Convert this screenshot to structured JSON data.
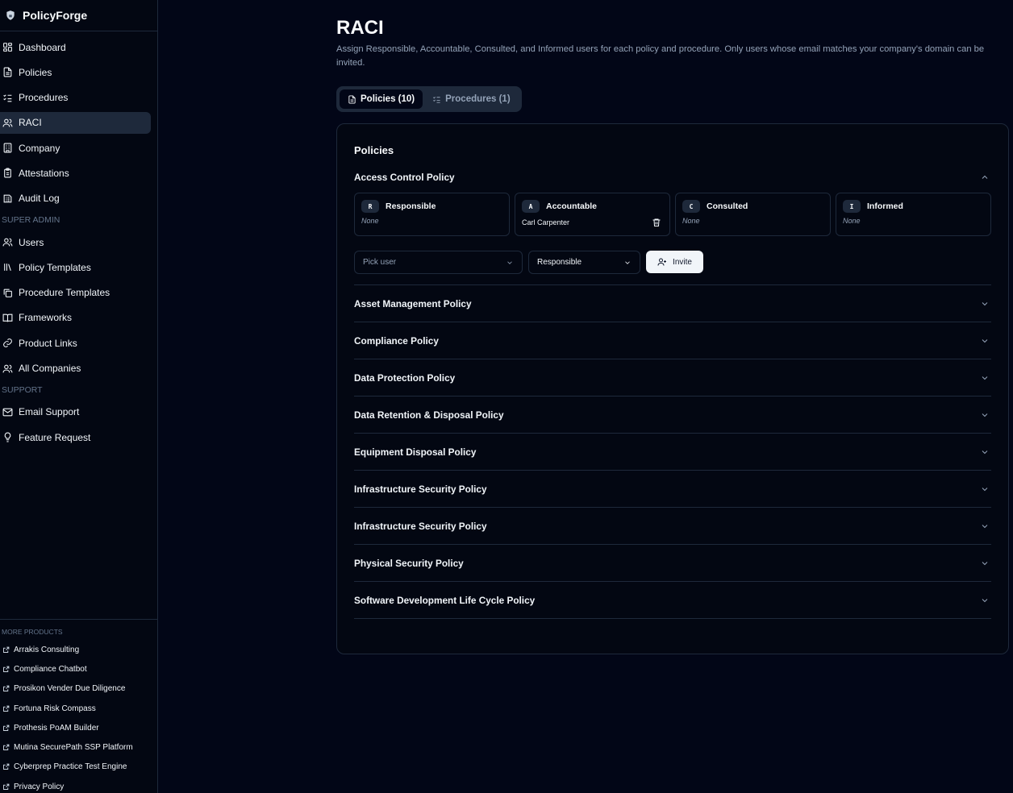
{
  "app": {
    "name": "PolicyForge",
    "logo_icon": "shield-logo-icon"
  },
  "sidebar": {
    "items": [
      {
        "label": "Dashboard",
        "icon": "grid-icon"
      },
      {
        "label": "Policies",
        "icon": "file-text-icon"
      },
      {
        "label": "Procedures",
        "icon": "list-checks-icon"
      },
      {
        "label": "RACI",
        "icon": "users-icon",
        "active": true
      },
      {
        "label": "Company",
        "icon": "building-icon"
      },
      {
        "label": "Attestations",
        "icon": "clipboard-icon"
      },
      {
        "label": "Audit Log",
        "icon": "log-icon"
      }
    ],
    "super_admin_label": "SUPER ADMIN",
    "admin_items": [
      {
        "label": "Users",
        "icon": "users-icon"
      },
      {
        "label": "Policy Templates",
        "icon": "library-icon"
      },
      {
        "label": "Procedure Templates",
        "icon": "copy-icon"
      },
      {
        "label": "Frameworks",
        "icon": "book-open-icon"
      },
      {
        "label": "Product Links",
        "icon": "link-icon"
      },
      {
        "label": "All Companies",
        "icon": "users-icon"
      }
    ],
    "support_label": "SUPPORT",
    "support_items": [
      {
        "label": "Email Support",
        "icon": "mail-icon"
      },
      {
        "label": "Feature Request",
        "icon": "lightbulb-icon"
      }
    ],
    "more_products_label": "MORE PRODUCTS",
    "more_products": [
      "Arrakis Consulting",
      "Compliance Chatbot",
      "Prosikon Vender Due Diligence",
      "Fortuna Risk Compass",
      "Prothesis PoAM Builder",
      "Mutina SecurePath SSP Platform",
      "Cyberprep Practice Test Engine",
      "Privacy Policy"
    ]
  },
  "main": {
    "title": "RACI",
    "description": "Assign Responsible, Accountable, Consulted, and Informed users for each policy and procedure. Only users whose email matches your company's domain can be invited.",
    "tabs": [
      {
        "label": "Policies (10)",
        "active": true
      },
      {
        "label": "Procedures (1)",
        "active": false
      }
    ],
    "card_title": "Policies",
    "expanded_policy": {
      "name": "Access Control Policy",
      "roles": [
        {
          "letter": "R",
          "label": "Responsible",
          "value": "None",
          "assigned": false
        },
        {
          "letter": "A",
          "label": "Accountable",
          "value": "Carl Carpenter",
          "assigned": true
        },
        {
          "letter": "C",
          "label": "Consulted",
          "value": "None",
          "assigned": false
        },
        {
          "letter": "I",
          "label": "Informed",
          "value": "None",
          "assigned": false
        }
      ],
      "pick_user_placeholder": "Pick user",
      "role_select_value": "Responsible",
      "invite_label": "Invite"
    },
    "collapsed_policies": [
      "Asset Management Policy",
      "Compliance Policy",
      "Data Protection Policy",
      "Data Retention & Disposal Policy",
      "Equipment Disposal Policy",
      "Infrastructure Security Policy",
      "Infrastructure Security Policy",
      "Physical Security Policy",
      "Software Development Life Cycle Policy"
    ]
  },
  "colors": {
    "background": "#020617",
    "sidebar": "#030712",
    "border": "#1e293b",
    "muted_text": "#94a3b8",
    "primary_button": "#f1f5f9"
  }
}
